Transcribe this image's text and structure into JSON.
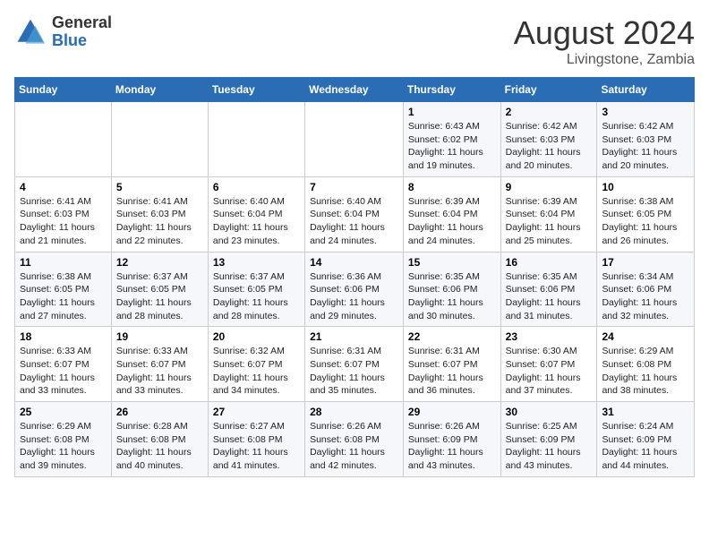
{
  "header": {
    "logo_general": "General",
    "logo_blue": "Blue",
    "month_year": "August 2024",
    "location": "Livingstone, Zambia"
  },
  "days_of_week": [
    "Sunday",
    "Monday",
    "Tuesday",
    "Wednesday",
    "Thursday",
    "Friday",
    "Saturday"
  ],
  "weeks": [
    [
      {
        "day": "",
        "info": ""
      },
      {
        "day": "",
        "info": ""
      },
      {
        "day": "",
        "info": ""
      },
      {
        "day": "",
        "info": ""
      },
      {
        "day": "1",
        "info": "Sunrise: 6:43 AM\nSunset: 6:02 PM\nDaylight: 11 hours and 19 minutes."
      },
      {
        "day": "2",
        "info": "Sunrise: 6:42 AM\nSunset: 6:03 PM\nDaylight: 11 hours and 20 minutes."
      },
      {
        "day": "3",
        "info": "Sunrise: 6:42 AM\nSunset: 6:03 PM\nDaylight: 11 hours and 20 minutes."
      }
    ],
    [
      {
        "day": "4",
        "info": "Sunrise: 6:41 AM\nSunset: 6:03 PM\nDaylight: 11 hours and 21 minutes."
      },
      {
        "day": "5",
        "info": "Sunrise: 6:41 AM\nSunset: 6:03 PM\nDaylight: 11 hours and 22 minutes."
      },
      {
        "day": "6",
        "info": "Sunrise: 6:40 AM\nSunset: 6:04 PM\nDaylight: 11 hours and 23 minutes."
      },
      {
        "day": "7",
        "info": "Sunrise: 6:40 AM\nSunset: 6:04 PM\nDaylight: 11 hours and 24 minutes."
      },
      {
        "day": "8",
        "info": "Sunrise: 6:39 AM\nSunset: 6:04 PM\nDaylight: 11 hours and 24 minutes."
      },
      {
        "day": "9",
        "info": "Sunrise: 6:39 AM\nSunset: 6:04 PM\nDaylight: 11 hours and 25 minutes."
      },
      {
        "day": "10",
        "info": "Sunrise: 6:38 AM\nSunset: 6:05 PM\nDaylight: 11 hours and 26 minutes."
      }
    ],
    [
      {
        "day": "11",
        "info": "Sunrise: 6:38 AM\nSunset: 6:05 PM\nDaylight: 11 hours and 27 minutes."
      },
      {
        "day": "12",
        "info": "Sunrise: 6:37 AM\nSunset: 6:05 PM\nDaylight: 11 hours and 28 minutes."
      },
      {
        "day": "13",
        "info": "Sunrise: 6:37 AM\nSunset: 6:05 PM\nDaylight: 11 hours and 28 minutes."
      },
      {
        "day": "14",
        "info": "Sunrise: 6:36 AM\nSunset: 6:06 PM\nDaylight: 11 hours and 29 minutes."
      },
      {
        "day": "15",
        "info": "Sunrise: 6:35 AM\nSunset: 6:06 PM\nDaylight: 11 hours and 30 minutes."
      },
      {
        "day": "16",
        "info": "Sunrise: 6:35 AM\nSunset: 6:06 PM\nDaylight: 11 hours and 31 minutes."
      },
      {
        "day": "17",
        "info": "Sunrise: 6:34 AM\nSunset: 6:06 PM\nDaylight: 11 hours and 32 minutes."
      }
    ],
    [
      {
        "day": "18",
        "info": "Sunrise: 6:33 AM\nSunset: 6:07 PM\nDaylight: 11 hours and 33 minutes."
      },
      {
        "day": "19",
        "info": "Sunrise: 6:33 AM\nSunset: 6:07 PM\nDaylight: 11 hours and 33 minutes."
      },
      {
        "day": "20",
        "info": "Sunrise: 6:32 AM\nSunset: 6:07 PM\nDaylight: 11 hours and 34 minutes."
      },
      {
        "day": "21",
        "info": "Sunrise: 6:31 AM\nSunset: 6:07 PM\nDaylight: 11 hours and 35 minutes."
      },
      {
        "day": "22",
        "info": "Sunrise: 6:31 AM\nSunset: 6:07 PM\nDaylight: 11 hours and 36 minutes."
      },
      {
        "day": "23",
        "info": "Sunrise: 6:30 AM\nSunset: 6:07 PM\nDaylight: 11 hours and 37 minutes."
      },
      {
        "day": "24",
        "info": "Sunrise: 6:29 AM\nSunset: 6:08 PM\nDaylight: 11 hours and 38 minutes."
      }
    ],
    [
      {
        "day": "25",
        "info": "Sunrise: 6:29 AM\nSunset: 6:08 PM\nDaylight: 11 hours and 39 minutes."
      },
      {
        "day": "26",
        "info": "Sunrise: 6:28 AM\nSunset: 6:08 PM\nDaylight: 11 hours and 40 minutes."
      },
      {
        "day": "27",
        "info": "Sunrise: 6:27 AM\nSunset: 6:08 PM\nDaylight: 11 hours and 41 minutes."
      },
      {
        "day": "28",
        "info": "Sunrise: 6:26 AM\nSunset: 6:08 PM\nDaylight: 11 hours and 42 minutes."
      },
      {
        "day": "29",
        "info": "Sunrise: 6:26 AM\nSunset: 6:09 PM\nDaylight: 11 hours and 43 minutes."
      },
      {
        "day": "30",
        "info": "Sunrise: 6:25 AM\nSunset: 6:09 PM\nDaylight: 11 hours and 43 minutes."
      },
      {
        "day": "31",
        "info": "Sunrise: 6:24 AM\nSunset: 6:09 PM\nDaylight: 11 hours and 44 minutes."
      }
    ]
  ]
}
